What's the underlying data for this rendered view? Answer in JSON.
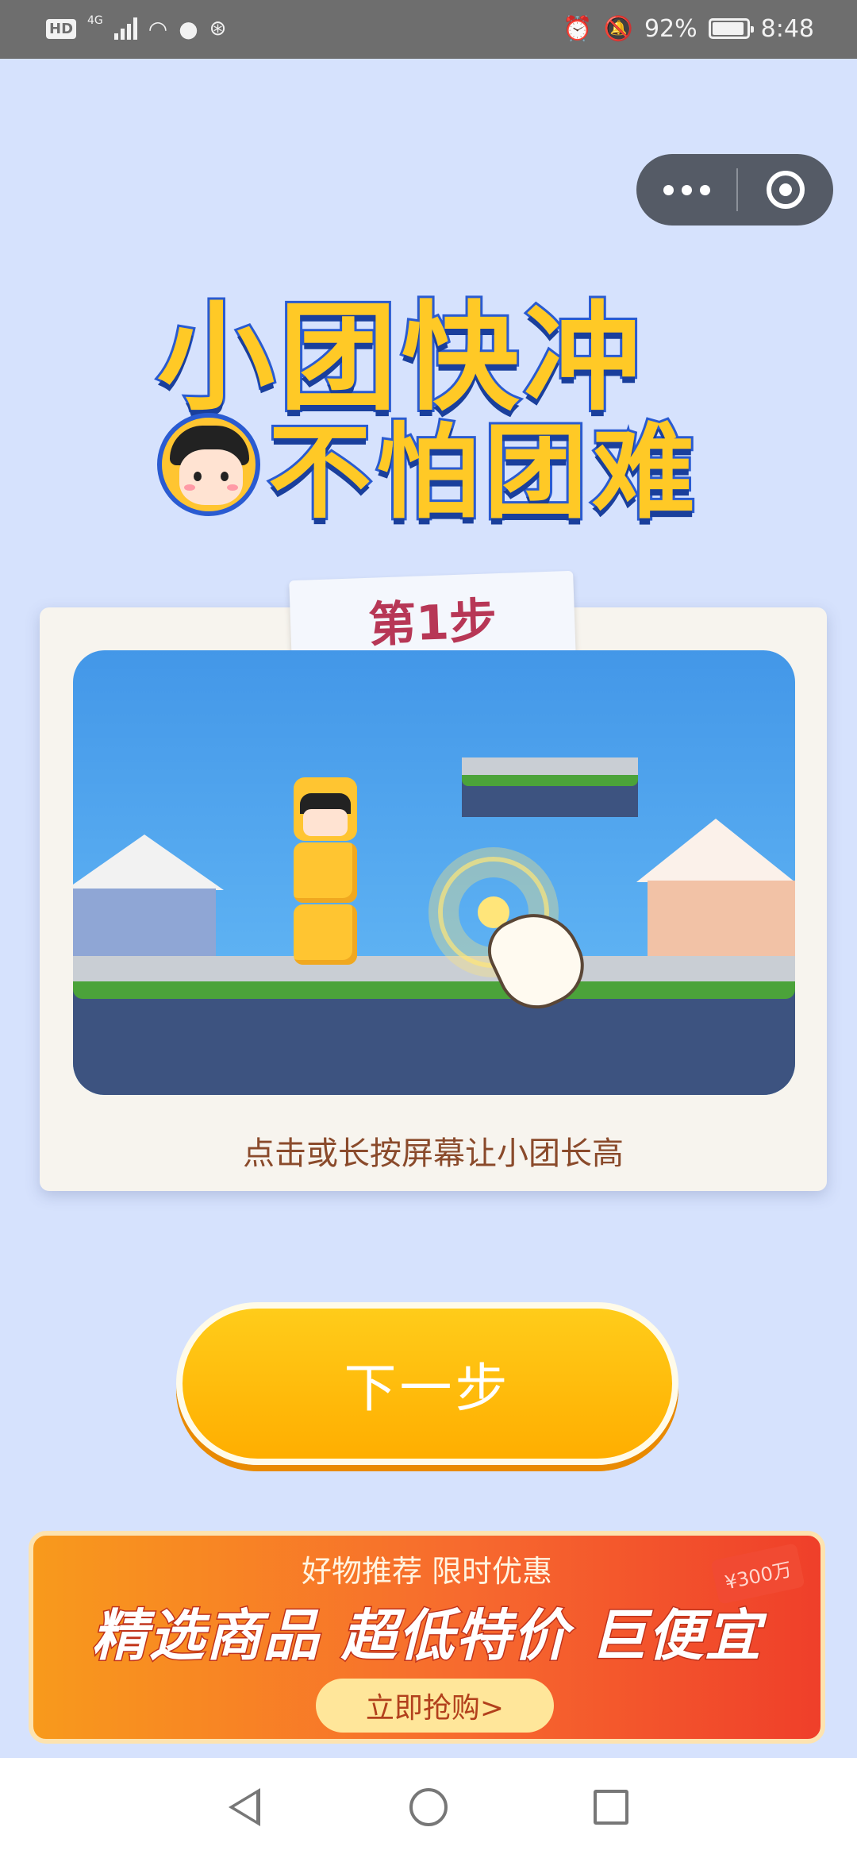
{
  "status_bar": {
    "hd": "HD",
    "network": "4G",
    "battery": "92%",
    "battery_level": 0.92,
    "time": "8:48"
  },
  "capsule": {
    "more_icon": "more-dots-icon",
    "close_icon": "target-close-icon"
  },
  "logo": {
    "line1": "小团快冲",
    "line2": "不怕团难"
  },
  "tutorial": {
    "step_label": "第1步",
    "caption": "点击或长按屏幕让小团长高"
  },
  "next_button": {
    "label": "下一步"
  },
  "ad": {
    "subtitle": "好物推荐 限时优惠",
    "headline": "精选商品 超低特价 巨便宜",
    "cta": "立即抢购>",
    "coupon": "¥300万"
  },
  "colors": {
    "background": "#d6e2fd",
    "button": "#ffb800",
    "step_text": "#b73756",
    "caption_text": "#8a4a2b"
  }
}
